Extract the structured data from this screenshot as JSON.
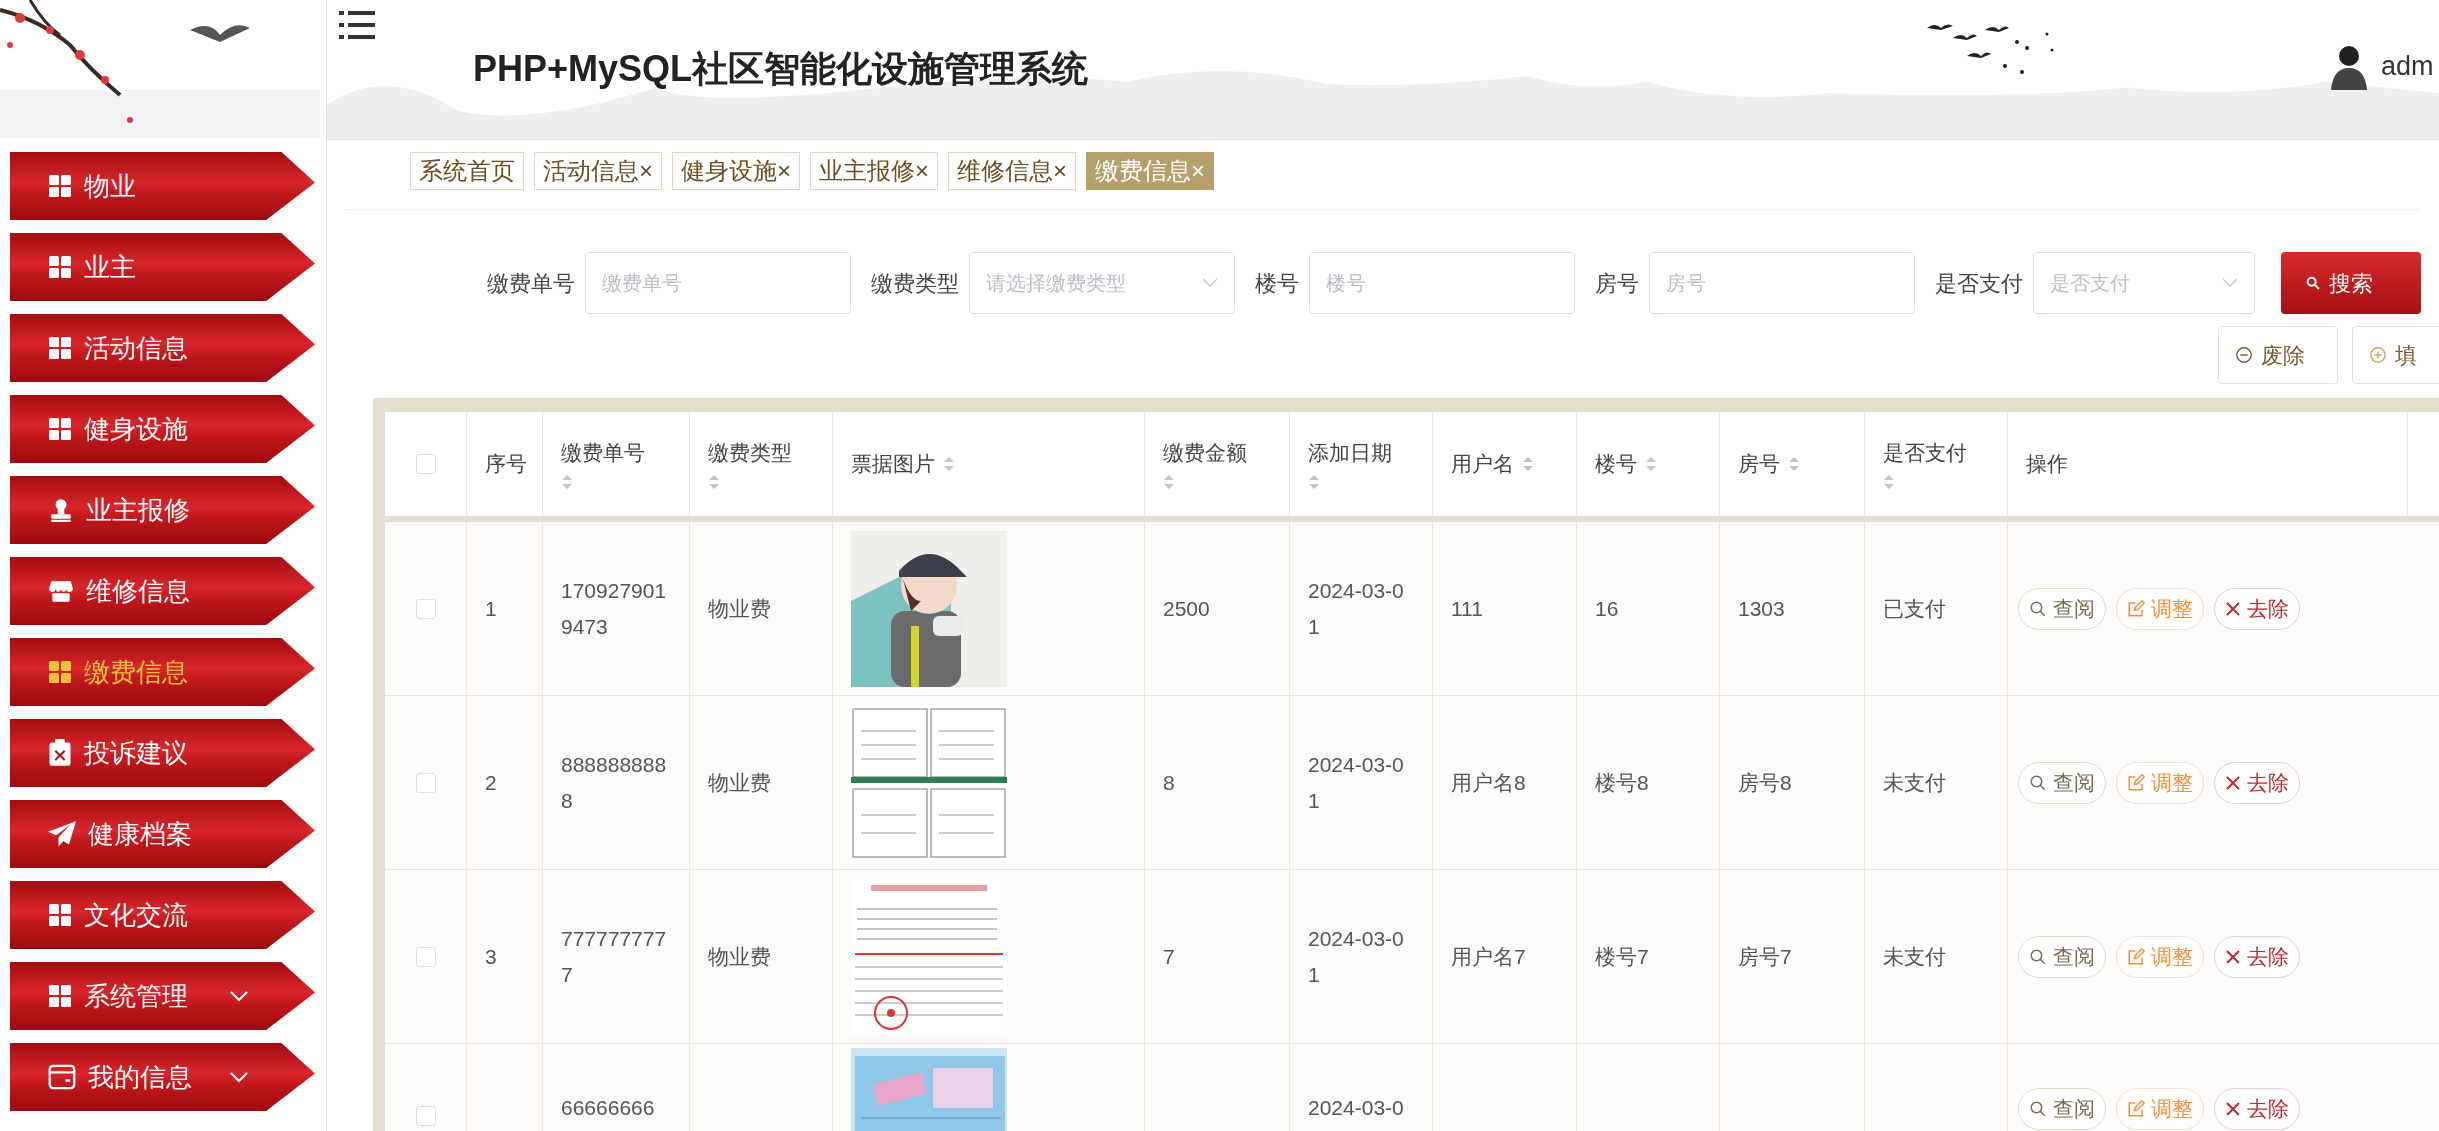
{
  "app": {
    "title": "PHP+MySQL社区智能化设施管理系统",
    "user": "adm"
  },
  "sidebar": {
    "items": [
      {
        "label": "物业",
        "selected": false,
        "kind": "link"
      },
      {
        "label": "业主",
        "selected": false,
        "kind": "link"
      },
      {
        "label": "活动信息",
        "selected": false,
        "kind": "link"
      },
      {
        "label": "健身设施",
        "selected": false,
        "kind": "link"
      },
      {
        "label": "业主报修",
        "selected": false,
        "kind": "link"
      },
      {
        "label": "维修信息",
        "selected": false,
        "kind": "link"
      },
      {
        "label": "缴费信息",
        "selected": true,
        "kind": "link"
      },
      {
        "label": "投诉建议",
        "selected": false,
        "kind": "link"
      },
      {
        "label": "健康档案",
        "selected": false,
        "kind": "link"
      },
      {
        "label": "文化交流",
        "selected": false,
        "kind": "link"
      },
      {
        "label": "系统管理",
        "selected": false,
        "kind": "group"
      },
      {
        "label": "我的信息",
        "selected": false,
        "kind": "group"
      }
    ]
  },
  "tabs": [
    {
      "label": "系统首页",
      "selected": false
    },
    {
      "label": "活动信息",
      "close": "×",
      "selected": false
    },
    {
      "label": "健身设施",
      "close": "×",
      "selected": false
    },
    {
      "label": "业主报修",
      "close": "×",
      "selected": false
    },
    {
      "label": "维修信息",
      "close": "×",
      "selected": false
    },
    {
      "label": "缴费信息",
      "close": "×",
      "selected": true
    }
  ],
  "filters": [
    {
      "label": "缴费单号",
      "kind": "input",
      "placeholder": "缴费单号"
    },
    {
      "label": "缴费类型",
      "kind": "select",
      "placeholder": "请选择缴费类型"
    },
    {
      "label": "楼号",
      "kind": "input",
      "placeholder": "楼号"
    },
    {
      "label": "房号",
      "kind": "input",
      "placeholder": "房号"
    },
    {
      "label": "是否支付",
      "kind": "select",
      "placeholder": "是否支付"
    }
  ],
  "search_button": "搜索",
  "toolbar": [
    "废除",
    "填"
  ],
  "table": {
    "all_checked": false,
    "columns": [
      {
        "label": "序号"
      },
      {
        "label": "缴费单号",
        "sortable": true
      },
      {
        "label": "缴费类型",
        "sortable": true
      },
      {
        "label": "票据图片",
        "sortable": true
      },
      {
        "label": "缴费金额",
        "sortable": true
      },
      {
        "label": "添加日期",
        "sortable": true
      },
      {
        "label": "用户名",
        "sortable": true
      },
      {
        "label": "楼号",
        "sortable": true
      },
      {
        "label": "房号",
        "sortable": true
      },
      {
        "label": "是否支付",
        "sortable": true
      },
      {
        "label": "操作"
      }
    ],
    "rows": [
      {
        "checked": false,
        "cells": [
          "1",
          "1709279019473",
          "物业费",
          null,
          "2500",
          "2024-03-01",
          "111",
          "16",
          "1303",
          "已支付"
        ],
        "picture": {
          "kind": "picture"
        },
        "actions": [
          "查阅",
          "调整",
          "去除"
        ]
      },
      {
        "checked": false,
        "cells": [
          "2",
          "8888888888",
          "物业费",
          null,
          "8",
          "2024-03-01",
          "用户名8",
          "楼号8",
          "房号8",
          "未支付"
        ],
        "picture": {
          "kind": "picture"
        },
        "actions": [
          "查阅",
          "调整",
          "去除"
        ]
      },
      {
        "checked": false,
        "cells": [
          "3",
          "7777777777",
          "物业费",
          null,
          "7",
          "2024-03-01",
          "用户名7",
          "楼号7",
          "房号7",
          "未支付"
        ],
        "picture": {
          "kind": "picture"
        },
        "actions": [
          "查阅",
          "调整",
          "去除"
        ]
      },
      {
        "checked": false,
        "cut": true,
        "cells": [
          null,
          "66666666",
          null,
          null,
          null,
          "2024-03-0",
          null,
          null,
          null,
          null
        ],
        "picture": {
          "kind": "picture"
        },
        "actions": [
          "查阅",
          "调整",
          "去除"
        ]
      }
    ]
  }
}
